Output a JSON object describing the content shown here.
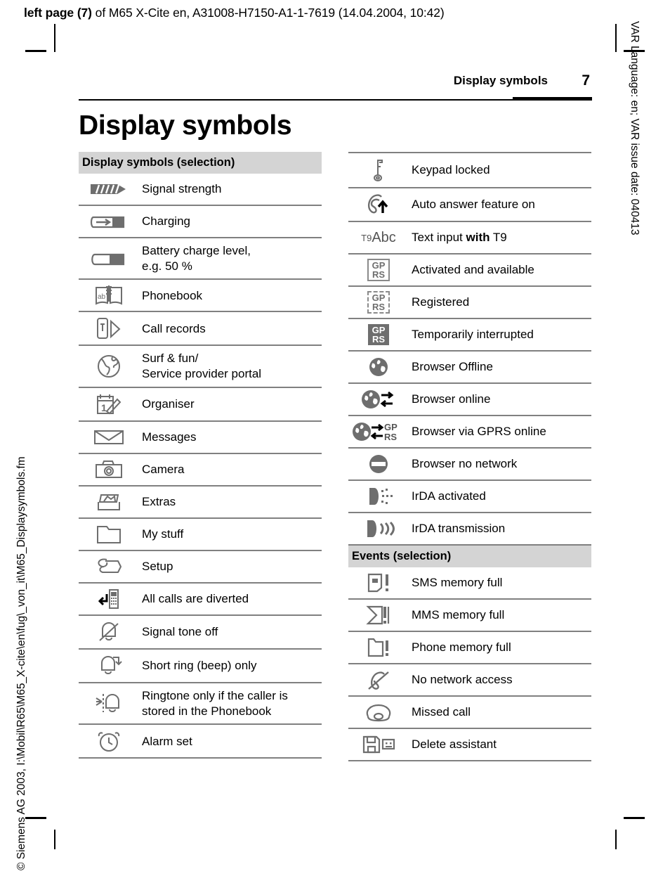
{
  "printline": {
    "bold": "left page (7)",
    "rest": " of M65 X-Cite en, A31008-H7150-A1-1-7619 (14.04.2004, 10:42)"
  },
  "side_text": {
    "right": "VAR Language: en; VAR issue date: 040413",
    "left": "© Siemens AG 2003, I:\\Mobil\\R65\\M65_X-cite\\en\\fug\\_von_it\\M65_Displaysymbols.fm"
  },
  "running_head": {
    "title": "Display symbols",
    "page": "7"
  },
  "page_title": "Display symbols",
  "colors": {
    "section_header_bg": "#d4d4d4",
    "rule_gray": "#808080",
    "icon_gray": "#6e6e6e",
    "icon_dark": "#58595b",
    "text": "#000000"
  },
  "left_column": {
    "section_title": "Display symbols (selection)",
    "rows": [
      {
        "icon": "signal-strength-icon",
        "label": "Signal strength"
      },
      {
        "icon": "charging-icon",
        "label": "Charging"
      },
      {
        "icon": "battery-level-icon",
        "label": "Battery charge level,\ne.g. 50 %"
      },
      {
        "icon": "phonebook-icon",
        "label": "Phonebook"
      },
      {
        "icon": "call-records-icon",
        "label": "Call records"
      },
      {
        "icon": "surf-and-fun-globe-icon",
        "label": "Surf & fun/\nService provider portal"
      },
      {
        "icon": "organiser-icon",
        "label": "Organiser"
      },
      {
        "icon": "messages-envelope-icon",
        "label": "Messages"
      },
      {
        "icon": "camera-icon",
        "label": "Camera"
      },
      {
        "icon": "extras-icon",
        "label": "Extras"
      },
      {
        "icon": "my-stuff-folder-icon",
        "label": "My stuff"
      },
      {
        "icon": "setup-wrench-icon",
        "label": "Setup"
      },
      {
        "icon": "calls-diverted-icon",
        "label": "All calls are diverted"
      },
      {
        "icon": "signal-tone-off-icon",
        "label": "Signal tone off"
      },
      {
        "icon": "short-ring-beep-icon",
        "label": "Short ring (beep) only"
      },
      {
        "icon": "ringtone-phonebook-only-icon",
        "label": "Ringtone only if the caller is\nstored in the Phonebook"
      },
      {
        "icon": "alarm-set-icon",
        "label": "Alarm set"
      }
    ]
  },
  "right_column": {
    "rows_top": [
      {
        "icon": "keypad-locked-key-icon",
        "label": "Keypad locked"
      },
      {
        "icon": "auto-answer-icon",
        "label": "Auto answer feature on"
      },
      {
        "icon": "t9-abc-icon",
        "label": "Text input with T9",
        "label_pre": "Text input ",
        "label_bold": "with",
        "label_post": " T9"
      },
      {
        "icon": "gprs-available-icon",
        "label": "Activated and available"
      },
      {
        "icon": "gprs-registered-icon",
        "label": "Registered"
      },
      {
        "icon": "gprs-interrupted-icon",
        "label": "Temporarily interrupted"
      },
      {
        "icon": "browser-offline-icon",
        "label": "Browser Offline"
      },
      {
        "icon": "browser-online-icon",
        "label": "Browser online"
      },
      {
        "icon": "browser-gprs-online-icon",
        "label": "Browser via GPRS online"
      },
      {
        "icon": "browser-no-network-icon",
        "label": "Browser no network"
      },
      {
        "icon": "irda-activated-icon",
        "label": "IrDA activated"
      },
      {
        "icon": "irda-transmission-icon",
        "label": "IrDA transmission"
      }
    ],
    "events_section_title": "Events (selection)",
    "rows_events": [
      {
        "icon": "sms-memory-full-icon",
        "label": "SMS memory full"
      },
      {
        "icon": "mms-memory-full-icon",
        "label": "MMS memory full"
      },
      {
        "icon": "phone-memory-full-icon",
        "label": "Phone memory full"
      },
      {
        "icon": "no-network-access-icon",
        "label": "No network access"
      },
      {
        "icon": "missed-call-icon",
        "label": "Missed call"
      },
      {
        "icon": "delete-assistant-icon",
        "label": "Delete assistant"
      }
    ],
    "gprs_text": {
      "line1": "GP",
      "line2": "RS"
    },
    "t9_text": {
      "sup": "T9",
      "main": "Abc"
    }
  }
}
